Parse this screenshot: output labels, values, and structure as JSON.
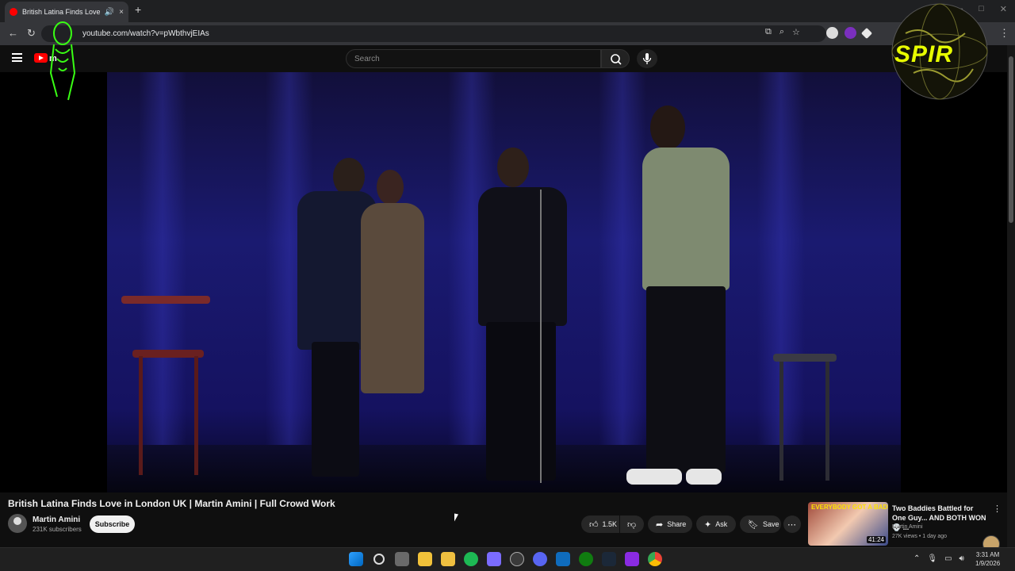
{
  "browser": {
    "tab_title": "British Latina Finds Love in",
    "url": "youtube.com/watch?v=pWbthvjEIAs",
    "new_tab": "+",
    "close_tab": "×"
  },
  "youtube": {
    "logo_text": "m",
    "search_placeholder": "Search"
  },
  "overlays": {
    "right_logo_text": "SPIR"
  },
  "video": {
    "title": "British Latina Finds Love in London UK | Martin Amini | Full Crowd Work",
    "channel_name": "Martin Amini",
    "subscribers": "231K subscribers",
    "subscribe_label": "Subscribe",
    "likes": "1.5K",
    "share_label": "Share",
    "ask_label": "Ask",
    "save_label": "Save"
  },
  "recommendation": {
    "thumb_text": "EVERYBODY GOT A BADDIE",
    "duration": "41:24",
    "title": "Two Baddies Battled for One Guy... AND BOTH WON 💀 ...",
    "channel": "Martin Amini",
    "meta": "27K views • 1 day ago"
  },
  "taskbar": {
    "time": "3:31 AM",
    "date": "1/9/2026"
  },
  "colors": {
    "yt_red": "#ff0000",
    "stage_blue": "#1a1a70",
    "rec_thumb_text": "#ffe300"
  }
}
